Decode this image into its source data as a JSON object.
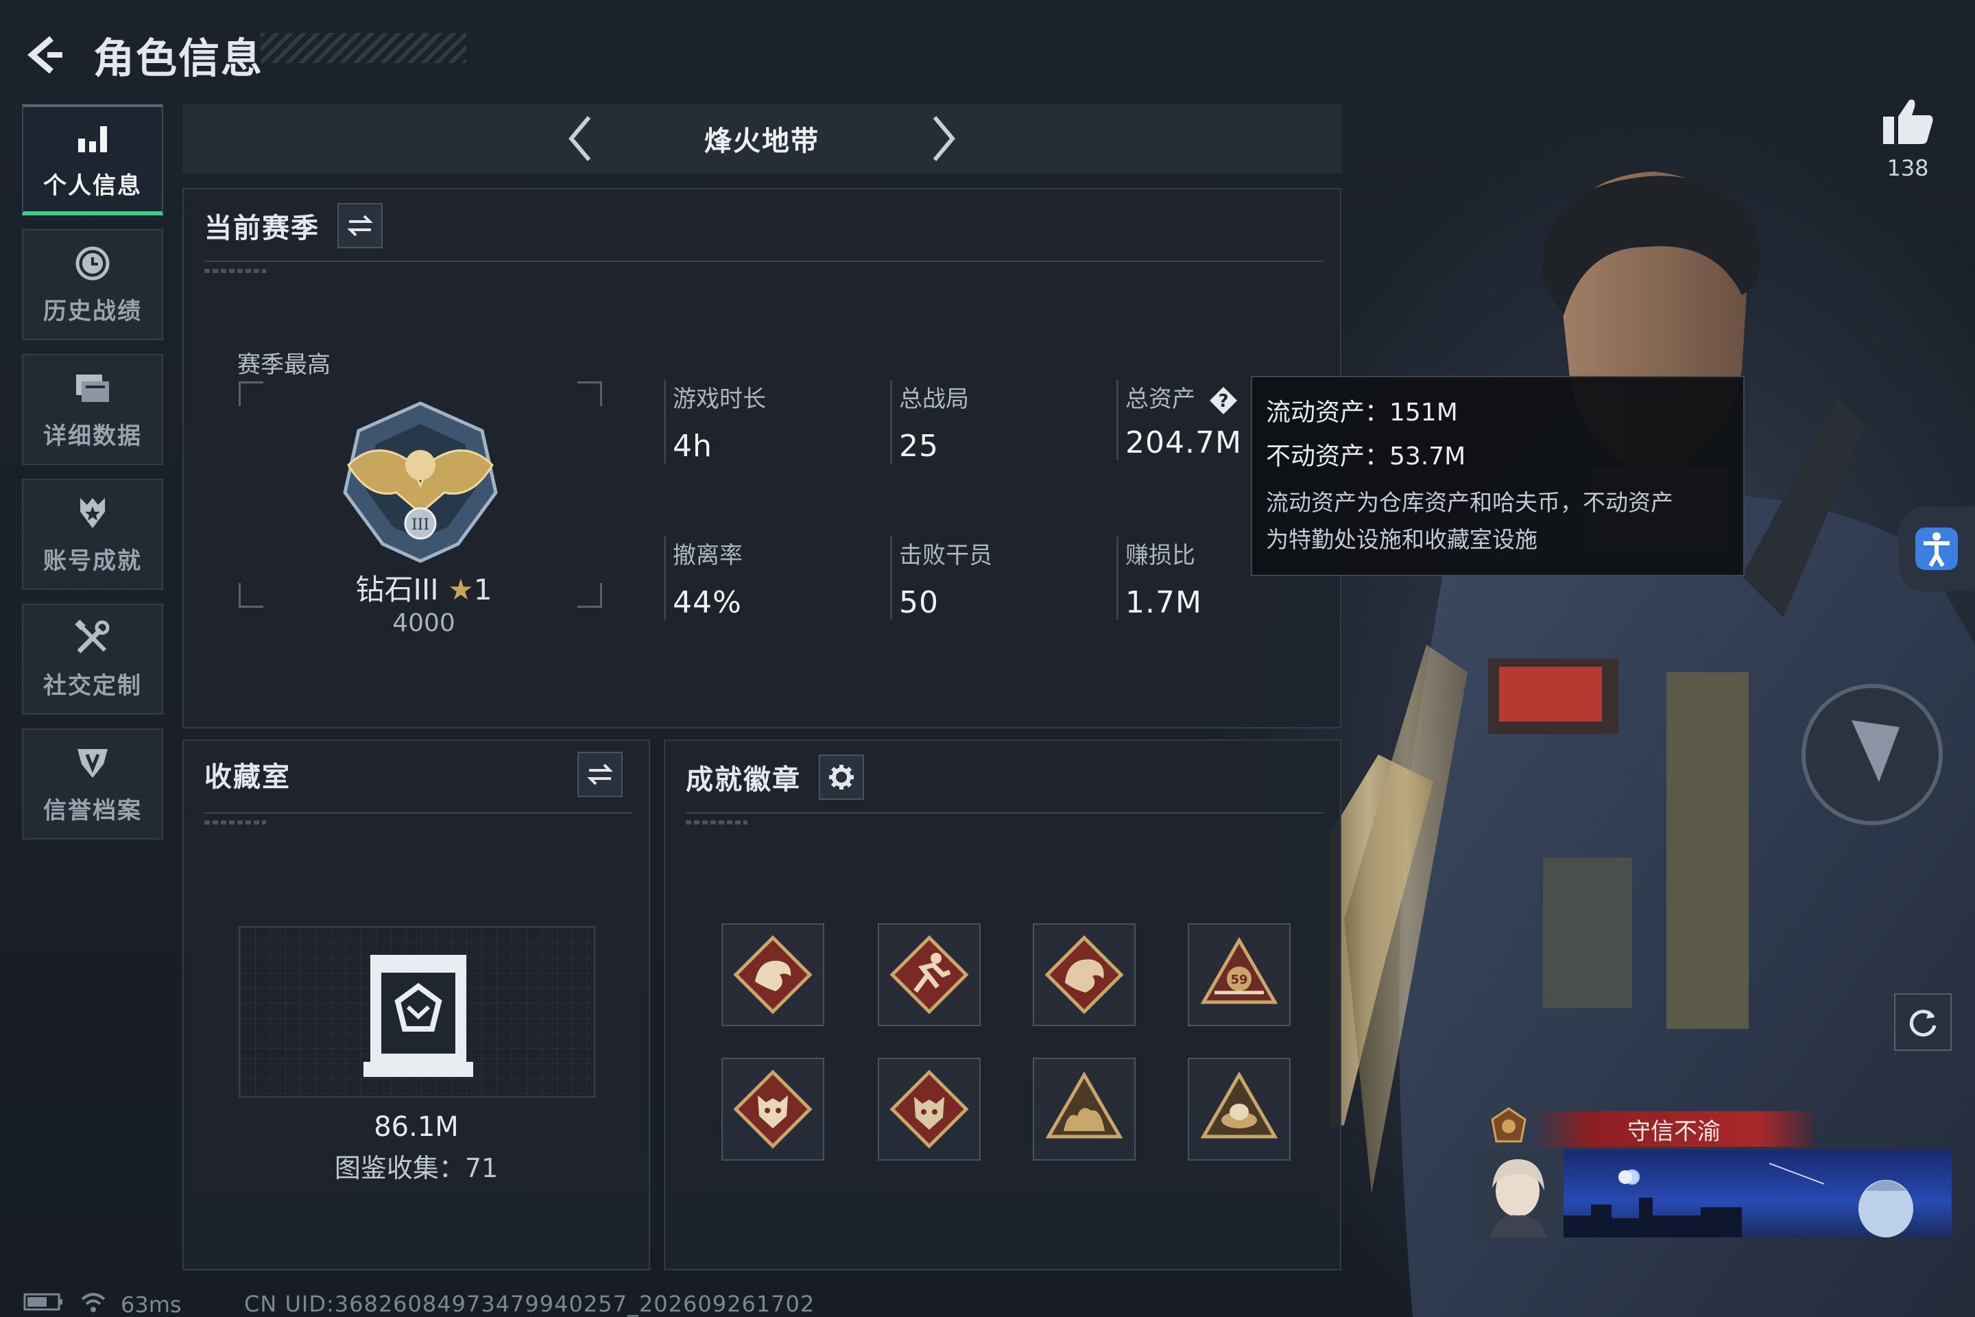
{
  "header": {
    "title": "角色信息"
  },
  "sidebar": {
    "items": [
      {
        "label": "个人信息",
        "icon": "bar-chart-icon",
        "active": true
      },
      {
        "label": "历史战绩",
        "icon": "history-clock-icon",
        "active": false
      },
      {
        "label": "详细数据",
        "icon": "folder-stack-icon",
        "active": false
      },
      {
        "label": "账号成就",
        "icon": "achievement-star-icon",
        "active": false
      },
      {
        "label": "社交定制",
        "icon": "tools-icon",
        "active": false
      },
      {
        "label": "信誉档案",
        "icon": "shield-credit-icon",
        "active": false
      }
    ]
  },
  "mode": {
    "title": "烽火地带"
  },
  "season": {
    "title": "当前赛季",
    "best_label": "赛季最高",
    "rank_name": "钻石III",
    "rank_stars": "1",
    "rank_score": "4000",
    "stats": {
      "play_time": {
        "label": "游戏时长",
        "value": "4h"
      },
      "total_games": {
        "label": "总战局",
        "value": "25"
      },
      "total_assets": {
        "label": "总资产",
        "value": "204.7M"
      },
      "extract_rate": {
        "label": "撤离率",
        "value": "44%"
      },
      "kills": {
        "label": "击败干员",
        "value": "50"
      },
      "profit_ratio": {
        "label": "赚损比",
        "value": "1.7M"
      }
    }
  },
  "tooltip": {
    "liquid": "流动资产：151M",
    "fixed": "不动资产：53.7M",
    "desc_line1": "流动资产为仓库资产和哈夫币，不动资产",
    "desc_line2": "为特勤处设施和收藏室设施"
  },
  "collection": {
    "title": "收藏室",
    "value": "86.1M",
    "count_text": "图鉴收集：71"
  },
  "badges": {
    "title": "成就徽章",
    "items": [
      "dragon-badge",
      "runner-badge",
      "dragon-badge-2",
      "team-59-badge",
      "wolf-badge",
      "wolf-badge-2",
      "beasts-badge",
      "nest-badge"
    ]
  },
  "likes": {
    "count": "138"
  },
  "player": {
    "title_tag": "守信不渝"
  },
  "status": {
    "ping": "63ms",
    "uid": "CN UID:36826084973479940257_202609261702"
  },
  "colors": {
    "active_accent": "#3ccf8e",
    "tooltip_bg": "#0e1014",
    "title_tag": "#a8282b"
  }
}
